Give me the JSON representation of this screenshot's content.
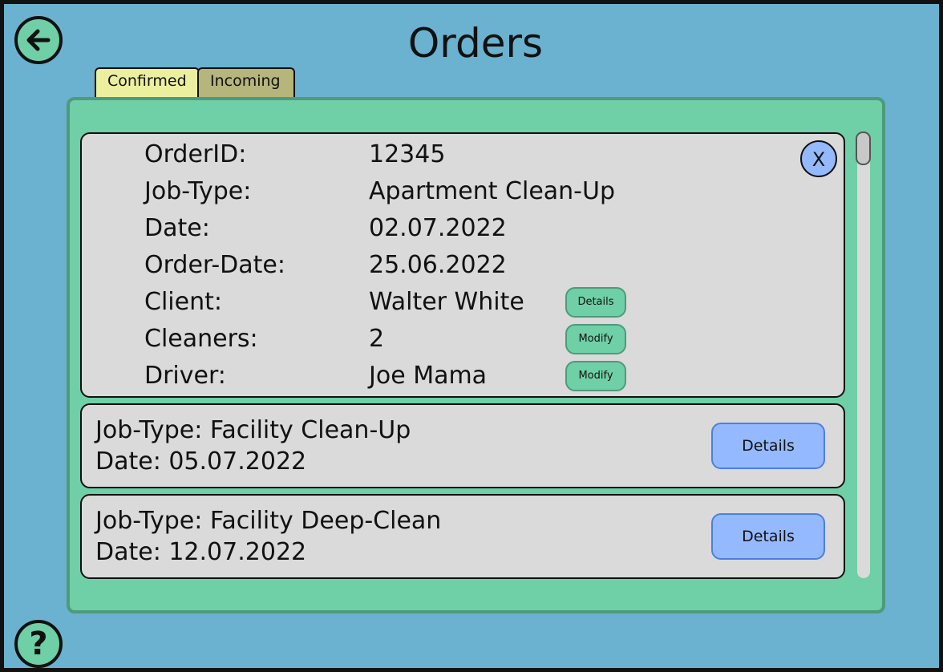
{
  "header": {
    "title": "Orders"
  },
  "icons": {
    "back": "arrow-left-icon",
    "help": "question-mark-icon"
  },
  "help_glyph": "?",
  "tabs": [
    {
      "label": "Confirmed",
      "active": true
    },
    {
      "label": "Incoming",
      "active": false
    }
  ],
  "expanded_order": {
    "close_label": "X",
    "rows": [
      {
        "label": "OrderID:",
        "value": "12345"
      },
      {
        "label": "Job-Type:",
        "value": "Apartment Clean-Up"
      },
      {
        "label": "Date:",
        "value": "02.07.2022"
      },
      {
        "label": "Order-Date:",
        "value": "25.06.2022"
      },
      {
        "label": "Client:",
        "value": "Walter White",
        "action": "Details"
      },
      {
        "label": "Cleaners:",
        "value": "2",
        "action": "Modify"
      },
      {
        "label": "Driver:",
        "value": "Joe Mama",
        "action": "Modify"
      }
    ]
  },
  "orders": [
    {
      "job_type": "Job-Type: Facility Clean-Up",
      "date": "Date: 05.07.2022",
      "button": "Details"
    },
    {
      "job_type": "Job-Type: Facility Deep-Clean",
      "date": "Date: 12.07.2022",
      "button": "Details"
    }
  ],
  "colors": {
    "background": "#6ab2cf",
    "panel": "#6fcfa6",
    "card": "#dadada",
    "tab_active": "#ecef9e",
    "tab_inactive": "#b5b57c",
    "button_blue": "#95b9ff"
  }
}
